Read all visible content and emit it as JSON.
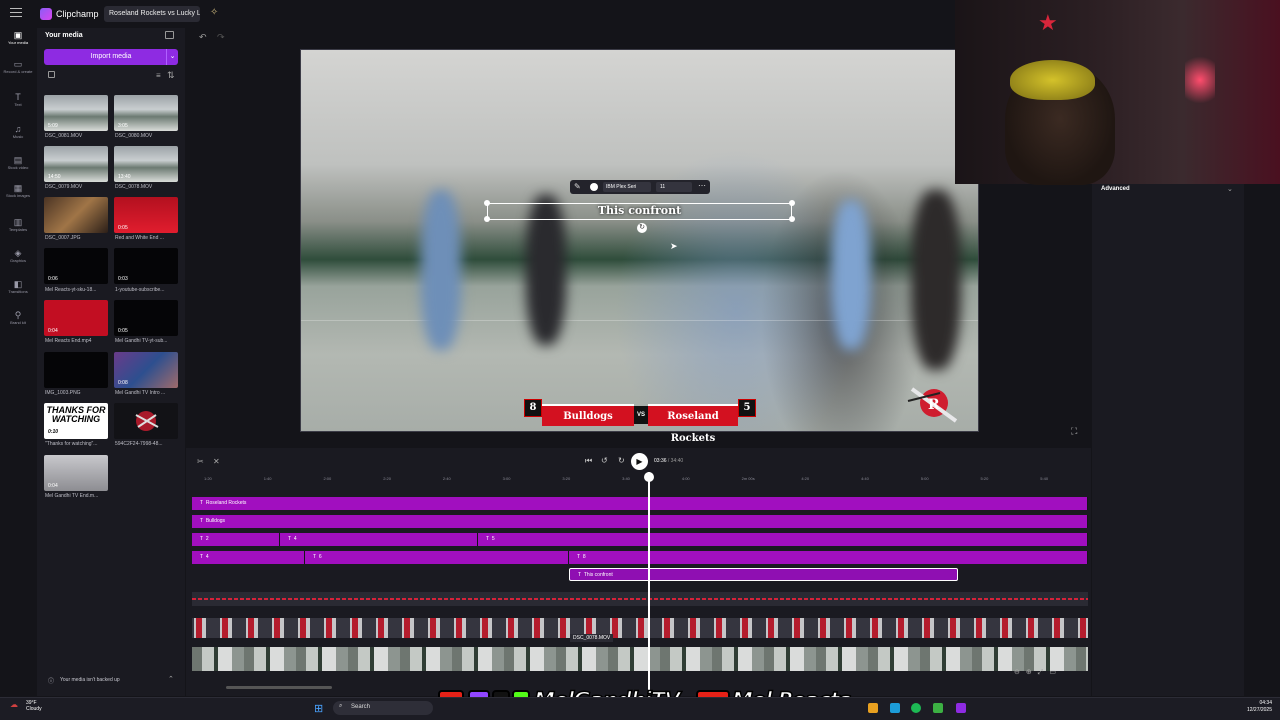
{
  "app": {
    "name": "Clipchamp",
    "project_tab": "Roseland Rockets vs Lucky L"
  },
  "rail": [
    {
      "icon": "▣",
      "label": "Your media"
    },
    {
      "icon": "▭",
      "label": "Record & create"
    },
    {
      "icon": "T",
      "label": "Text"
    },
    {
      "icon": "♫",
      "label": "Music"
    },
    {
      "icon": "▤",
      "label": "Stock video"
    },
    {
      "icon": "▦",
      "label": "Stock images"
    },
    {
      "icon": "▥",
      "label": "Templates"
    },
    {
      "icon": "◈",
      "label": "Graphics"
    },
    {
      "icon": "◧",
      "label": "Transitions"
    },
    {
      "icon": "⚲",
      "label": "Brand kit"
    }
  ],
  "media": {
    "title": "Your media",
    "import_label": "Import media",
    "backup_note": "Your media isn't backed up",
    "items": [
      {
        "label": "DSC_0081.MOV",
        "dur": "5:09"
      },
      {
        "label": "DSC_0080.MOV",
        "dur": "3:05"
      },
      {
        "label": "DSC_0079.MOV",
        "dur": "14:50"
      },
      {
        "label": "DSC_0078.MOV",
        "dur": "13:40"
      },
      {
        "label": "DSC_0007.JPG",
        "dur": ""
      },
      {
        "label": "Red and White End ...",
        "dur": "0:05"
      },
      {
        "label": "Mel Reacts-yt-sku-18...",
        "dur": "0:06"
      },
      {
        "label": "1-youtube-subscribe...",
        "dur": "0:03"
      },
      {
        "label": "Mel Reacts End.mp4",
        "dur": "0:04"
      },
      {
        "label": "Mel Gandhi TV-yt-sub...",
        "dur": "0:05"
      },
      {
        "label": "IMG_1003.PNG",
        "dur": ""
      },
      {
        "label": "Mel Gandhi TV Intro ...",
        "dur": "0:08"
      },
      {
        "label": "\"Thanks for watching\"...",
        "dur": "0:10"
      },
      {
        "label": "594C2F24-7998-48...",
        "dur": ""
      },
      {
        "label": "Mel Gandhi TV End.m...",
        "dur": "0:04"
      }
    ],
    "thanks_text": "THANKS FOR WATCHING"
  },
  "preview": {
    "text_overlay": "This confront",
    "toolbar_font": "IBM Plex Seri",
    "toolbar_size": "11",
    "score_left": "8",
    "team_left": "Bulldogs",
    "vs": "VS",
    "team_right": "Roseland Rockets",
    "score_right": "5"
  },
  "props": {
    "advanced_label": "Advanced"
  },
  "timeline": {
    "current_time": "03:36",
    "total_time": "/ 34:40",
    "ruler_ticks": [
      "1:20",
      "1:40",
      "2:00",
      "2:20",
      "2:40",
      "3:00",
      "3:20",
      "3:40",
      "4:00",
      "2m 00s",
      "4:20",
      "4:40",
      "5:00",
      "5:20",
      "5:40"
    ],
    "tracks": [
      {
        "clips": [
          {
            "label": "Roseland Rockets"
          }
        ]
      },
      {
        "clips": [
          {
            "label": "Bulldogs"
          }
        ]
      },
      {
        "clips": [
          {
            "label": "2"
          },
          {
            "label": "4"
          },
          {
            "label": "5"
          }
        ]
      },
      {
        "clips": [
          {
            "label": "4"
          },
          {
            "label": "6"
          },
          {
            "label": "8"
          }
        ]
      },
      {
        "clips": [
          {
            "label": "This confront"
          }
        ]
      }
    ],
    "video_clip_label": "DSC_0078.MOV"
  },
  "watermark": {
    "channel1": "MelGandhiTV",
    "channel2": "Mel Reacts"
  },
  "taskbar": {
    "weather_temp": "39°F",
    "weather_desc": "Cloudy",
    "search_label": "Search",
    "time": "04:34",
    "date": "12/27/2025"
  },
  "colors": {
    "accent": "#8e2be2",
    "text_clip": "#a10fbf",
    "scoreboard_red": "#d31120"
  }
}
